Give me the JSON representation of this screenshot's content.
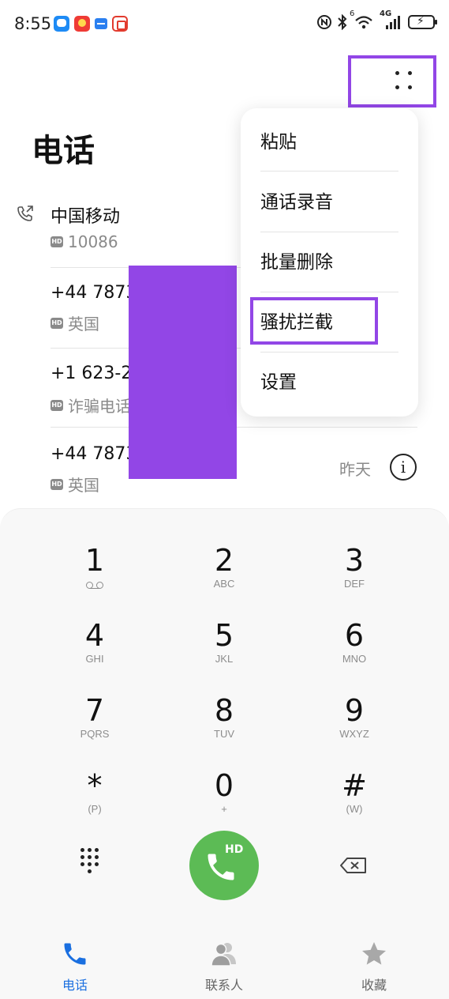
{
  "status_bar": {
    "time": "8:55",
    "notification_icons": [
      "message-app-icon",
      "app-notification-icon",
      "bank-app-icon",
      "taobao-icon"
    ],
    "system_icons": [
      "nfc-icon",
      "bluetooth-icon",
      "wifi-6-icon",
      "signal-4g-icon",
      "battery-charging-icon"
    ],
    "wifi_badge": "6",
    "network_label": "4G"
  },
  "header": {
    "title": "电话",
    "more_button_icon": "more-dots-icon"
  },
  "call_log": [
    {
      "name": "中国移动",
      "number": "10086",
      "hd": "HD",
      "type_icon": "outgoing-call-icon"
    },
    {
      "name": "+44 7873",
      "location": "英国",
      "hd": "HD"
    },
    {
      "name": "+1 623-2",
      "location": "诈骗电话",
      "hd": "HD"
    },
    {
      "name": "+44 7873",
      "location": "英国",
      "hd": "HD",
      "time": "昨天",
      "info_icon": "info-icon"
    }
  ],
  "menu": {
    "items": [
      "粘贴",
      "通话录音",
      "批量删除",
      "骚扰拦截",
      "设置"
    ],
    "highlighted": "骚扰拦截"
  },
  "dialpad": {
    "keys": [
      {
        "digit": "1",
        "letters": ""
      },
      {
        "digit": "2",
        "letters": "ABC"
      },
      {
        "digit": "3",
        "letters": "DEF"
      },
      {
        "digit": "4",
        "letters": "GHI"
      },
      {
        "digit": "5",
        "letters": "JKL"
      },
      {
        "digit": "6",
        "letters": "MNO"
      },
      {
        "digit": "7",
        "letters": "PQRS"
      },
      {
        "digit": "8",
        "letters": "TUV"
      },
      {
        "digit": "9",
        "letters": "WXYZ"
      },
      {
        "digit": "*",
        "letters": "(P)"
      },
      {
        "digit": "0",
        "letters": "+"
      },
      {
        "digit": "#",
        "letters": "(W)"
      }
    ],
    "call_button_badge": "HD",
    "call_button_color": "#5cbb55"
  },
  "bottom_nav": {
    "items": [
      {
        "label": "电话",
        "icon": "phone-icon",
        "active": true
      },
      {
        "label": "联系人",
        "icon": "contacts-icon",
        "active": false
      },
      {
        "label": "收藏",
        "icon": "star-icon",
        "active": false
      }
    ],
    "active_color": "#1a6fe0"
  },
  "annotation_color": "#9246e6"
}
